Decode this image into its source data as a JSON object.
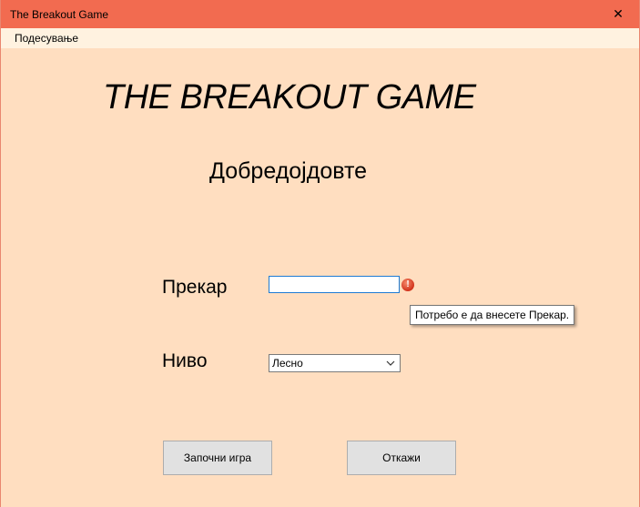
{
  "window": {
    "title": "The Breakout Game",
    "close_glyph": "✕"
  },
  "menu": {
    "items": [
      {
        "label": "Подесување"
      }
    ]
  },
  "main": {
    "heading": "THE BREAKOUT GAME",
    "welcome": "Добредојдовте"
  },
  "form": {
    "name_label": "Прекар",
    "name_value": "",
    "error_icon": "error-icon",
    "error_tooltip": "Потребо е да внесете Прекар.",
    "level_label": "Ниво",
    "level_selected": "Лесно"
  },
  "buttons": {
    "start": "Започни игра",
    "cancel": "Откажи"
  },
  "colors": {
    "titlebar": "#F26B50",
    "background": "#FFDEC0",
    "menubar": "#FFF2E0",
    "input_focus_border": "#1F7BD3",
    "button_face": "#E1E1E1",
    "error_red": "#D2331C"
  }
}
